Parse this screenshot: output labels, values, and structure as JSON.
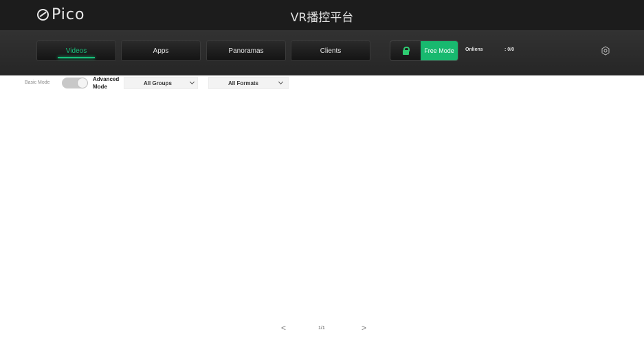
{
  "header": {
    "logo_text": "Pico",
    "title": "VR播控平台"
  },
  "nav": {
    "tabs": [
      {
        "label": "Videos",
        "active": true
      },
      {
        "label": "Apps",
        "active": false
      },
      {
        "label": "Panoramas",
        "active": false
      },
      {
        "label": "Clients",
        "active": false
      }
    ],
    "mode_label": "Free Mode",
    "online_label": "Onliens",
    "online_count": ": 0/0",
    "accent_color": "#17c07a",
    "mode_color": "#18b96f"
  },
  "toolbar": {
    "basic_mode_label": "Basic Mode",
    "advanced_mode_label": "Advanced Mode",
    "groups_select": "All Groups",
    "formats_select": "All Formats"
  },
  "pagination": {
    "prev": "<",
    "page": "1/1",
    "next": ">"
  },
  "icons": [
    "pico-logo-icon",
    "lock-open-icon",
    "settings-icon",
    "chevron-down-icon"
  ]
}
